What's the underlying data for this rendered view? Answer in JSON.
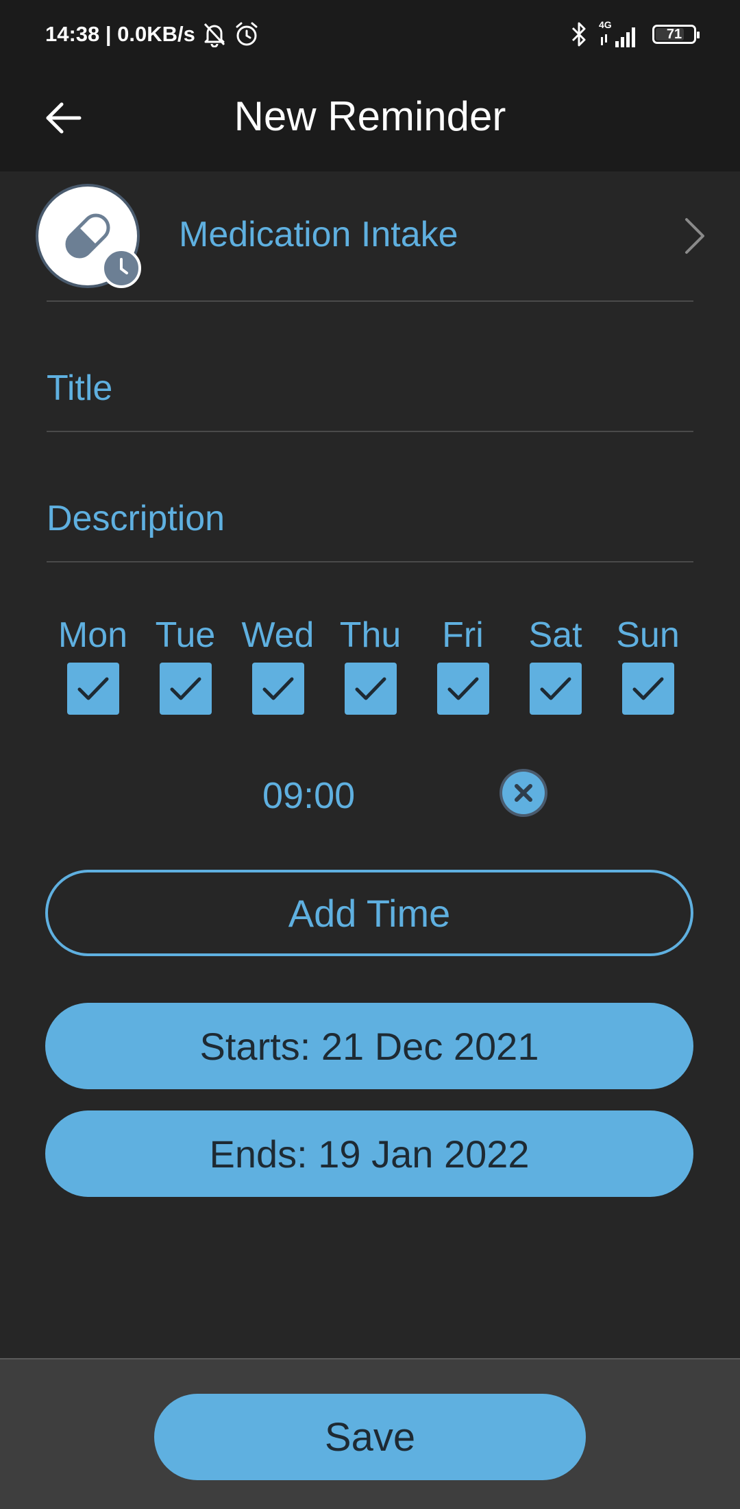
{
  "status_bar": {
    "time_speed": "14:38 | 0.0KB/s",
    "network_label": "4G",
    "battery_level": "71",
    "icons": [
      "mute-bell-icon",
      "alarm-icon",
      "bluetooth-icon",
      "signal-icon",
      "battery-icon"
    ]
  },
  "header": {
    "title": "New Reminder",
    "back_icon": "arrow-left-icon"
  },
  "category": {
    "label": "Medication Intake",
    "icon": "pill-clock-icon"
  },
  "form": {
    "title_placeholder": "Title",
    "title_value": "",
    "description_placeholder": "Description",
    "description_value": ""
  },
  "days": [
    {
      "label": "Mon",
      "checked": true
    },
    {
      "label": "Tue",
      "checked": true
    },
    {
      "label": "Wed",
      "checked": true
    },
    {
      "label": "Thu",
      "checked": true
    },
    {
      "label": "Fri",
      "checked": true
    },
    {
      "label": "Sat",
      "checked": true
    },
    {
      "label": "Sun",
      "checked": true
    }
  ],
  "times": [
    "09:00"
  ],
  "buttons": {
    "add_time": "Add Time",
    "starts": "Starts: 21 Dec 2021",
    "ends": "Ends: 19 Jan 2022",
    "save": "Save"
  },
  "colors": {
    "accent": "#5FB0E0",
    "background": "#262626",
    "header": "#1B1B1B",
    "bottom_bar": "#3E3E3E"
  }
}
